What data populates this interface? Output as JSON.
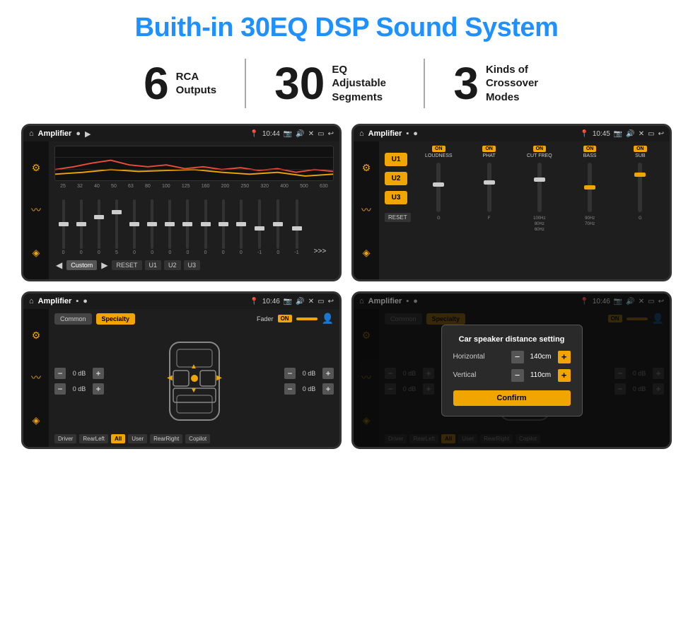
{
  "page": {
    "title": "Buith-in 30EQ DSP Sound System",
    "stats": [
      {
        "number": "6",
        "label": "RCA\nOutputs"
      },
      {
        "number": "30",
        "label": "EQ Adjustable\nSegments"
      },
      {
        "number": "3",
        "label": "Kinds of\nCrossover Modes"
      }
    ],
    "screens": [
      {
        "id": "eq-screen",
        "status": {
          "title": "Amplifier",
          "time": "10:44"
        },
        "type": "eq",
        "freqs": [
          "25",
          "32",
          "40",
          "50",
          "63",
          "80",
          "100",
          "125",
          "160",
          "200",
          "250",
          "320",
          "400",
          "500",
          "630"
        ],
        "vals": [
          "0",
          "0",
          "0",
          "5",
          "0",
          "0",
          "0",
          "0",
          "0",
          "0",
          "0",
          "-1",
          "0",
          "-1"
        ],
        "buttons": [
          "Custom",
          "RESET",
          "U1",
          "U2",
          "U3"
        ]
      },
      {
        "id": "crossover-screen",
        "status": {
          "title": "Amplifier",
          "time": "10:45"
        },
        "type": "crossover",
        "uButtons": [
          "U1",
          "U2",
          "U3"
        ],
        "channels": [
          {
            "name": "LOUDNESS",
            "on": true
          },
          {
            "name": "PHAT",
            "on": true
          },
          {
            "name": "CUT FREQ",
            "on": true
          },
          {
            "name": "BASS",
            "on": true
          },
          {
            "name": "SUB",
            "on": true
          }
        ]
      },
      {
        "id": "speaker-screen",
        "status": {
          "title": "Amplifier",
          "time": "10:46"
        },
        "type": "speaker",
        "tabs": [
          "Common",
          "Specialty"
        ],
        "activeTab": "Specialty",
        "fader": "Fader",
        "faderOn": "ON",
        "positions": [
          "Driver",
          "RearLeft",
          "All",
          "User",
          "RearRight",
          "Copilot"
        ],
        "dbValues": [
          "0 dB",
          "0 dB",
          "0 dB",
          "0 dB"
        ]
      },
      {
        "id": "dialog-screen",
        "status": {
          "title": "Amplifier",
          "time": "10:46"
        },
        "type": "speaker-dialog",
        "tabs": [
          "Common",
          "Specialty"
        ],
        "activeTab": "Specialty",
        "dialog": {
          "title": "Car speaker distance setting",
          "horizontal": {
            "label": "Horizontal",
            "value": "140cm"
          },
          "vertical": {
            "label": "Vertical",
            "value": "110cm"
          },
          "confirmLabel": "Confirm"
        },
        "positions": [
          "Driver",
          "RearLeft",
          "All",
          "User",
          "RearRight",
          "Copilot"
        ]
      }
    ]
  }
}
